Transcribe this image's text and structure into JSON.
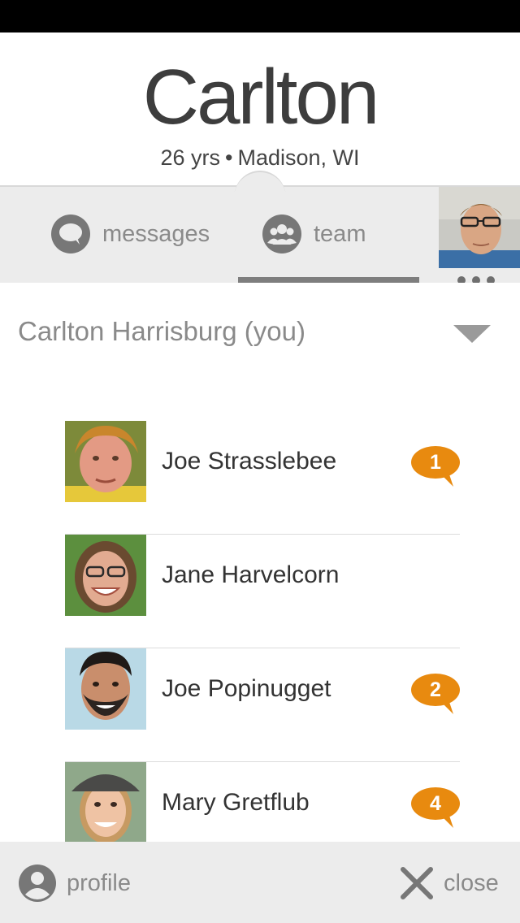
{
  "profile": {
    "name": "Carlton",
    "age": "26 yrs",
    "separator": "•",
    "location": "Madison, WI"
  },
  "tabs": [
    {
      "label": "messages",
      "icon": "chat-bubble-icon",
      "selected": false
    },
    {
      "label": "team",
      "icon": "group-icon",
      "selected": true
    }
  ],
  "team_selector": {
    "value": "Carlton Harrisburg (you)",
    "icon": "caret-down-icon"
  },
  "members": [
    {
      "name": "Joe Strasslebee",
      "badge": "1"
    },
    {
      "name": "Jane Harvelcorn",
      "badge": ""
    },
    {
      "name": "Joe Popinugget",
      "badge": "2"
    },
    {
      "name": "Mary Gretflub",
      "badge": "4"
    }
  ],
  "bottom": {
    "profile_label": "profile",
    "close_label": "close"
  },
  "colors": {
    "badge": "#e88a0f",
    "bar_bg": "#ececec",
    "icon_grey": "#777777"
  }
}
